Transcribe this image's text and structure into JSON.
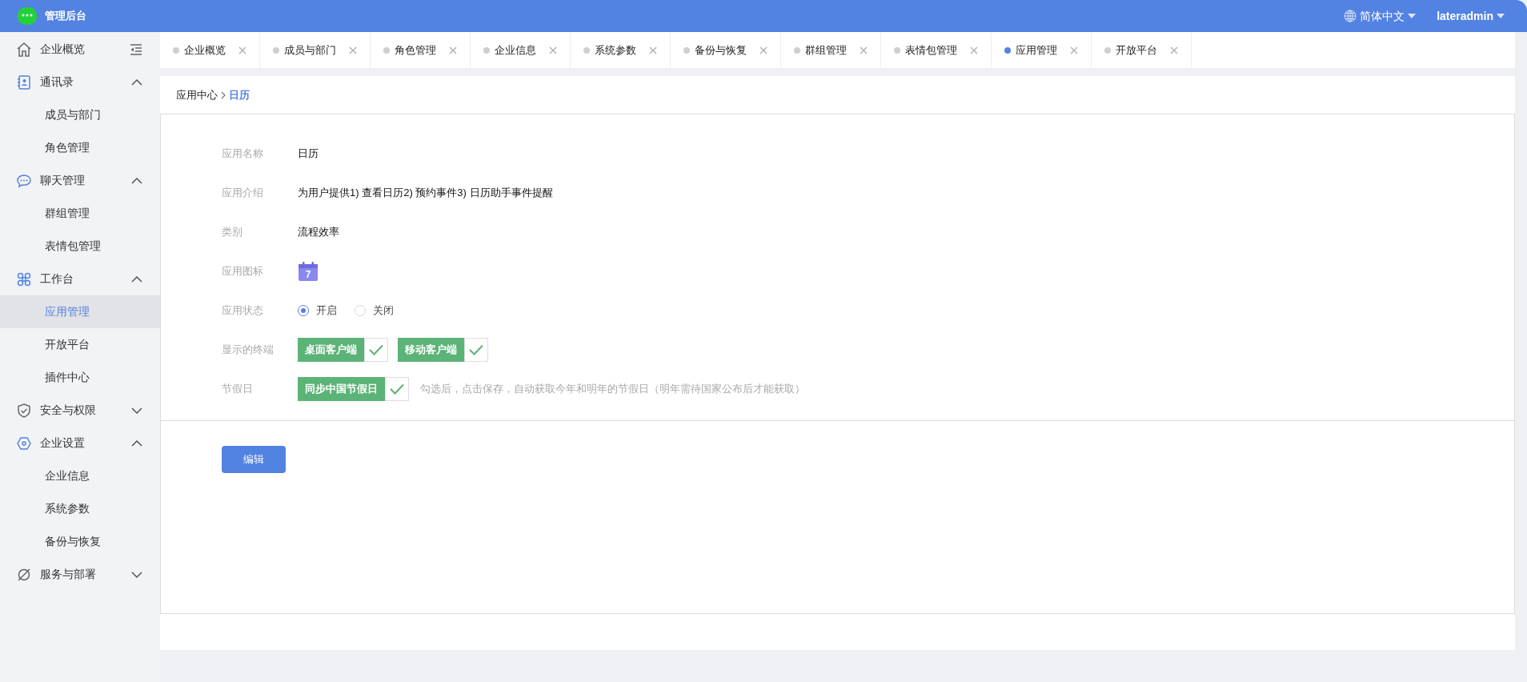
{
  "header": {
    "title": "管理后台",
    "language": "简体中文",
    "user": "lateradmin"
  },
  "sidebar": {
    "items": [
      {
        "kind": "link",
        "label": "企业概览",
        "selected": false
      },
      {
        "kind": "group",
        "label": "通讯录",
        "expanded": true,
        "children": [
          {
            "label": "成员与部门",
            "selected": false
          },
          {
            "label": "角色管理",
            "selected": false
          }
        ]
      },
      {
        "kind": "group",
        "label": "聊天管理",
        "expanded": true,
        "children": [
          {
            "label": "群组管理",
            "selected": false
          },
          {
            "label": "表情包管理",
            "selected": false
          }
        ]
      },
      {
        "kind": "group",
        "label": "工作台",
        "expanded": true,
        "children": [
          {
            "label": "应用管理",
            "selected": true
          },
          {
            "label": "开放平台",
            "selected": false
          },
          {
            "label": "插件中心",
            "selected": false
          }
        ]
      },
      {
        "kind": "group",
        "label": "安全与权限",
        "expanded": false
      },
      {
        "kind": "group",
        "label": "企业设置",
        "expanded": true,
        "children": [
          {
            "label": "企业信息",
            "selected": false
          },
          {
            "label": "系统参数",
            "selected": false
          },
          {
            "label": "备份与恢复",
            "selected": false
          }
        ]
      },
      {
        "kind": "group",
        "label": "服务与部署",
        "expanded": false
      }
    ]
  },
  "tabs": [
    {
      "label": "企业概览",
      "selected": false
    },
    {
      "label": "成员与部门",
      "selected": false
    },
    {
      "label": "角色管理",
      "selected": false
    },
    {
      "label": "企业信息",
      "selected": false
    },
    {
      "label": "系统参数",
      "selected": false
    },
    {
      "label": "备份与恢复",
      "selected": false
    },
    {
      "label": "群组管理",
      "selected": false
    },
    {
      "label": "表情包管理",
      "selected": false
    },
    {
      "label": "应用管理",
      "selected": true
    },
    {
      "label": "开放平台",
      "selected": false
    }
  ],
  "breadcrumb": [
    "应用中心",
    "日历"
  ],
  "form": {
    "fields": [
      {
        "kind": "text",
        "label": "应用名称",
        "value": "日历"
      },
      {
        "kind": "text",
        "label": "应用介绍",
        "value": "为用户提供1) 查看日历2) 预约事件3) 日历助手事件提醒"
      },
      {
        "kind": "text",
        "label": "类别",
        "value": "流程效率"
      },
      {
        "kind": "icon",
        "label": "应用图标",
        "icon_text": "7"
      },
      {
        "kind": "radio",
        "label": "应用状态",
        "options": [
          {
            "label": "开启",
            "selected": true
          },
          {
            "label": "关闭",
            "selected": false
          }
        ]
      },
      {
        "kind": "checks",
        "label": "显示的终端",
        "options": [
          {
            "label": "桌面客户端",
            "checked": true
          },
          {
            "label": "移动客户端",
            "checked": true
          }
        ]
      },
      {
        "kind": "checks",
        "label": "节假日",
        "options": [
          {
            "label": "同步中国节假日",
            "checked": true
          }
        ],
        "hint": "勾选后，点击保存，自动获取今年和明年的节假日（明年需待国家公布后才能获取）"
      }
    ]
  },
  "edit_button": "编辑"
}
